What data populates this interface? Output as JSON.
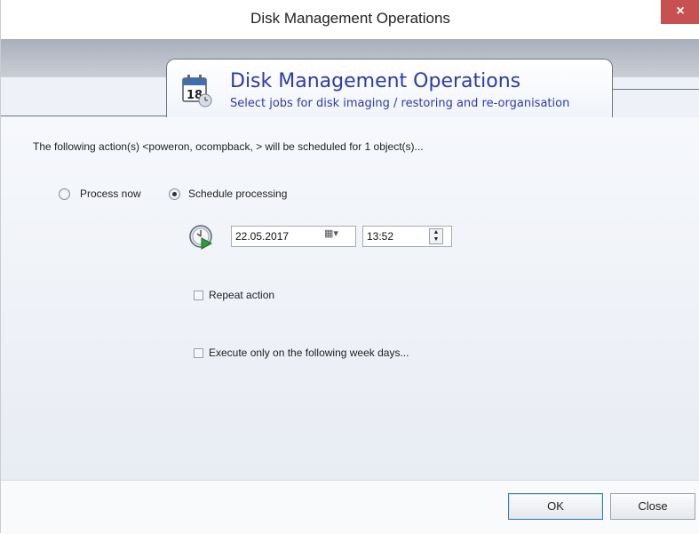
{
  "window": {
    "title": "Disk Management Operations",
    "close_glyph": "×"
  },
  "header": {
    "title": "Disk Management Operations",
    "subtitle": "Select jobs for disk imaging / restoring and re-organisation",
    "calendar_day": "18",
    "icon": "calendar-icon"
  },
  "info_text": "The following action(s) <poweron, ocompback, > will be scheduled for 1 object(s)...",
  "processing": {
    "process_now_label": "Process now",
    "process_now_selected": false,
    "schedule_label": "Schedule processing",
    "schedule_selected": true
  },
  "schedule": {
    "date": "22.05.2017",
    "time": "13:52",
    "clock_icon": "clock-icon"
  },
  "options": {
    "repeat_label": "Repeat action",
    "repeat_checked": false,
    "weekdays_label": "Execute only on the following week days...",
    "weekdays_checked": false
  },
  "footer": {
    "ok_label": "OK",
    "close_label": "Close"
  },
  "colors": {
    "accent_text": "#2f3aa8",
    "close_button": "#c75050"
  }
}
